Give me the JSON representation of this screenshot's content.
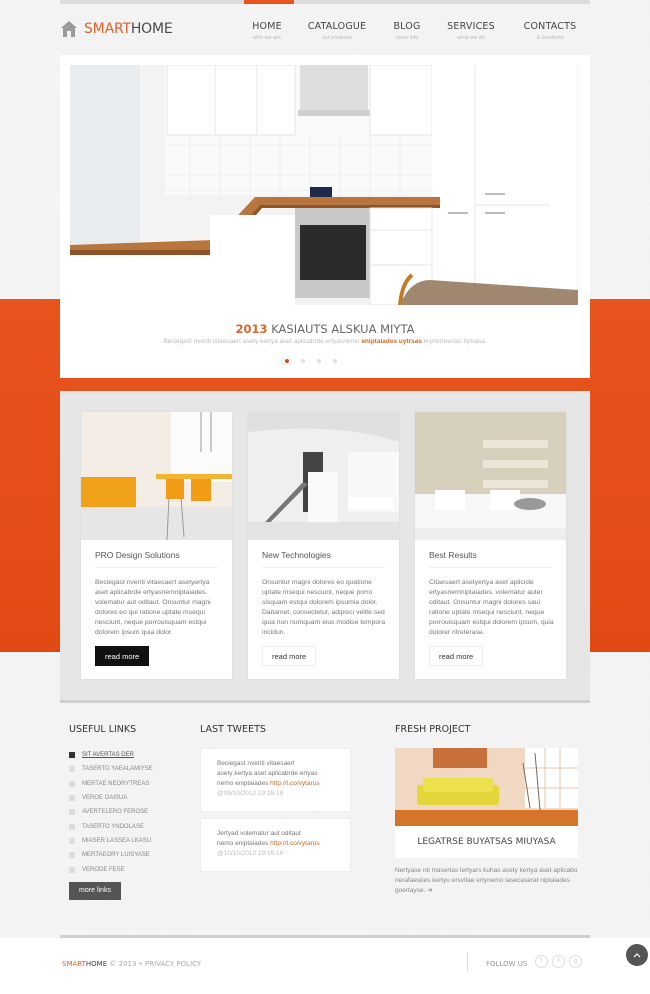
{
  "header": {
    "logo_primary": "SMART",
    "logo_secondary": "HOME",
    "nav": [
      {
        "label": "HOME",
        "sub": "who we are",
        "active": true
      },
      {
        "label": "CATALOGUE",
        "sub": "our products"
      },
      {
        "label": "BLOG",
        "sub": "more info"
      },
      {
        "label": "SERVICES",
        "sub": "what we do"
      },
      {
        "label": "CONTACTS",
        "sub": "& locations"
      }
    ]
  },
  "slider": {
    "title_year": "2013",
    "title_text": " KASIAUTS ALSKUA MIYTA",
    "desc_before": "Beciegast nveriti vitaesaert  asety kertya aset aplicabrde ertyasnemo ",
    "desc_highlight": "eniptaiades uytrsas",
    "desc_after": " leyrterteertas bytrasa.",
    "active_slide": 1,
    "slide_count": 4
  },
  "features": [
    {
      "title": "PRO Design Solutions",
      "text": "Beciegast nveriti vitaesaert asetyertya aset aplicabrde ertyasnemniptaiades. volematur aut oditaut. Onsuntur magni dolores eo qui ratione uptate msequi nesciunt, neque porrouisquam estqui dolorem ipsum quia dolor.",
      "button": "read more"
    },
    {
      "title": "New Technologies",
      "text": "Onsuntur magni dolores eo quatione uptate msequi nesciunt, neque porro sisquam estqui dolorem ipsumia dolor. Daitamet, consectetur, adipisci velite sed quia non numquam eius modise tempora incidun.",
      "button": "read more"
    },
    {
      "title": "Best Results",
      "text": "Citaesaert asetyertya aset aplicrde ertyasnemniptaiades. volematur auter oditaut. Onsuntur magni dolores saui ratione uptate msequi nesciunt, neque porrouisquam estqui dolorem ipsum, quia dolorer ntreterase.",
      "button": "read more"
    }
  ],
  "useful_links": {
    "heading": "USEFUL LINKS",
    "items": [
      "SIT AVERTAS DER",
      "TASERTO YAEALAMIYSE",
      "MERTAE NEORYTREAS",
      "VEROE OAISUA",
      "AVERTELERO FEROSE",
      "TASERTO YNDOLASE",
      "MIASER LASSEA LKASU",
      "MERTAEORY LUISYASE",
      "VERODE FESE"
    ],
    "button": "more links"
  },
  "tweets": {
    "heading": "LAST TWEETS",
    "items": [
      {
        "line1": "Beciegast nveriti vitaesaert",
        "line2": "asety kertya aset aplicabrde ertyas",
        "line3": "nemo eniptaiades ",
        "link": "http://t.co/vytarus",
        "date": "@09/10/2012 19:15:18"
      },
      {
        "line1": "Jertyad volematur aut oditaut",
        "line2": "nemo eniptaiades ",
        "link": "http://t.co/vytarus",
        "date": "@10/10/2012 19:15:18"
      }
    ]
  },
  "fresh_project": {
    "heading": "FRESH PROJECT",
    "title": "LEGATRSE BUYATSAS MIUYASA",
    "desc": "Nertyase nti masertas lertyars kuhas asety kertya aset aplicabo nerafaeskes kertyu ersvitae ertynemo lasecaserat niptaiades goertayse. ➔"
  },
  "footer": {
    "brand_primary": "SMART",
    "brand_secondary": "HOME",
    "copyright": " © 2013 • PRIVACY POLICY",
    "follow": "FOLLOW US",
    "social": [
      "twitter",
      "facebook",
      "google-plus"
    ],
    "to_top": "^"
  },
  "colors": {
    "accent": "#e8541e",
    "highlight": "#d2692a"
  }
}
